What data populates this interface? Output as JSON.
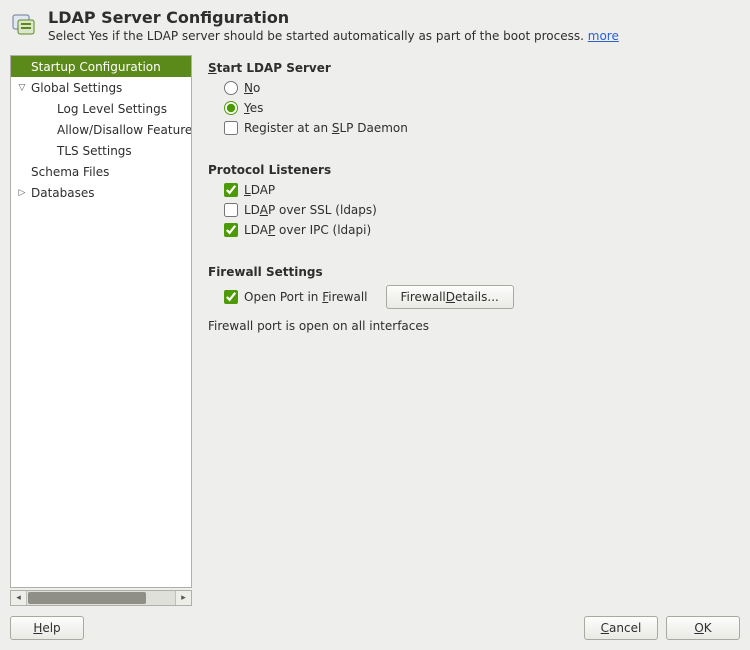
{
  "header": {
    "title": "LDAP Server Configuration",
    "subtitle_prefix": "Select Yes if the LDAP server should be started automatically as part of the boot process. ",
    "more_label": "more"
  },
  "tree": {
    "items": [
      {
        "label": "Startup Configuration",
        "depth": 0,
        "expander": "",
        "selected": true
      },
      {
        "label": "Global Settings",
        "depth": 0,
        "expander": "▽",
        "selected": false
      },
      {
        "label": "Log Level Settings",
        "depth": 1,
        "expander": "",
        "selected": false
      },
      {
        "label": "Allow/Disallow Features",
        "depth": 1,
        "expander": "",
        "selected": false
      },
      {
        "label": "TLS Settings",
        "depth": 1,
        "expander": "",
        "selected": false
      },
      {
        "label": "Schema Files",
        "depth": 0,
        "expander": "",
        "selected": false
      },
      {
        "label": "Databases",
        "depth": 0,
        "expander": "▷",
        "selected": false
      }
    ]
  },
  "sections": {
    "start": {
      "title_pre": "",
      "title_mn": "S",
      "title_post": "tart LDAP Server",
      "no": {
        "pre": "",
        "mn": "N",
        "post": "o",
        "checked": false
      },
      "yes": {
        "pre": "",
        "mn": "Y",
        "post": "es",
        "checked": true
      },
      "slp": {
        "pre": "Register at an ",
        "mn": "S",
        "post": "LP Daemon",
        "checked": false
      }
    },
    "protocol": {
      "title": "Protocol Listeners",
      "ldap": {
        "pre": "",
        "mn": "L",
        "post": "DAP",
        "checked": true
      },
      "ldaps": {
        "pre1": "LD",
        "mn1": "A",
        "post1": "P over SSL (ldaps)",
        "checked": false
      },
      "ldapi": {
        "pre1": "LDA",
        "mn1": "P",
        "post1": " over IPC (ldapi)",
        "checked": true
      }
    },
    "firewall": {
      "title": "Firewall Settings",
      "open_port": {
        "pre": "Open Port in ",
        "mn": "F",
        "post": "irewall",
        "checked": true
      },
      "details_btn": {
        "pre": "Firewall ",
        "mn": "D",
        "post": "etails..."
      },
      "status": "Firewall port is open on all interfaces"
    }
  },
  "footer": {
    "help": {
      "pre": "",
      "mn": "H",
      "post": "elp"
    },
    "cancel": {
      "pre": "",
      "mn": "C",
      "post": "ancel"
    },
    "ok": {
      "pre": "",
      "mn": "O",
      "post": "K"
    }
  }
}
